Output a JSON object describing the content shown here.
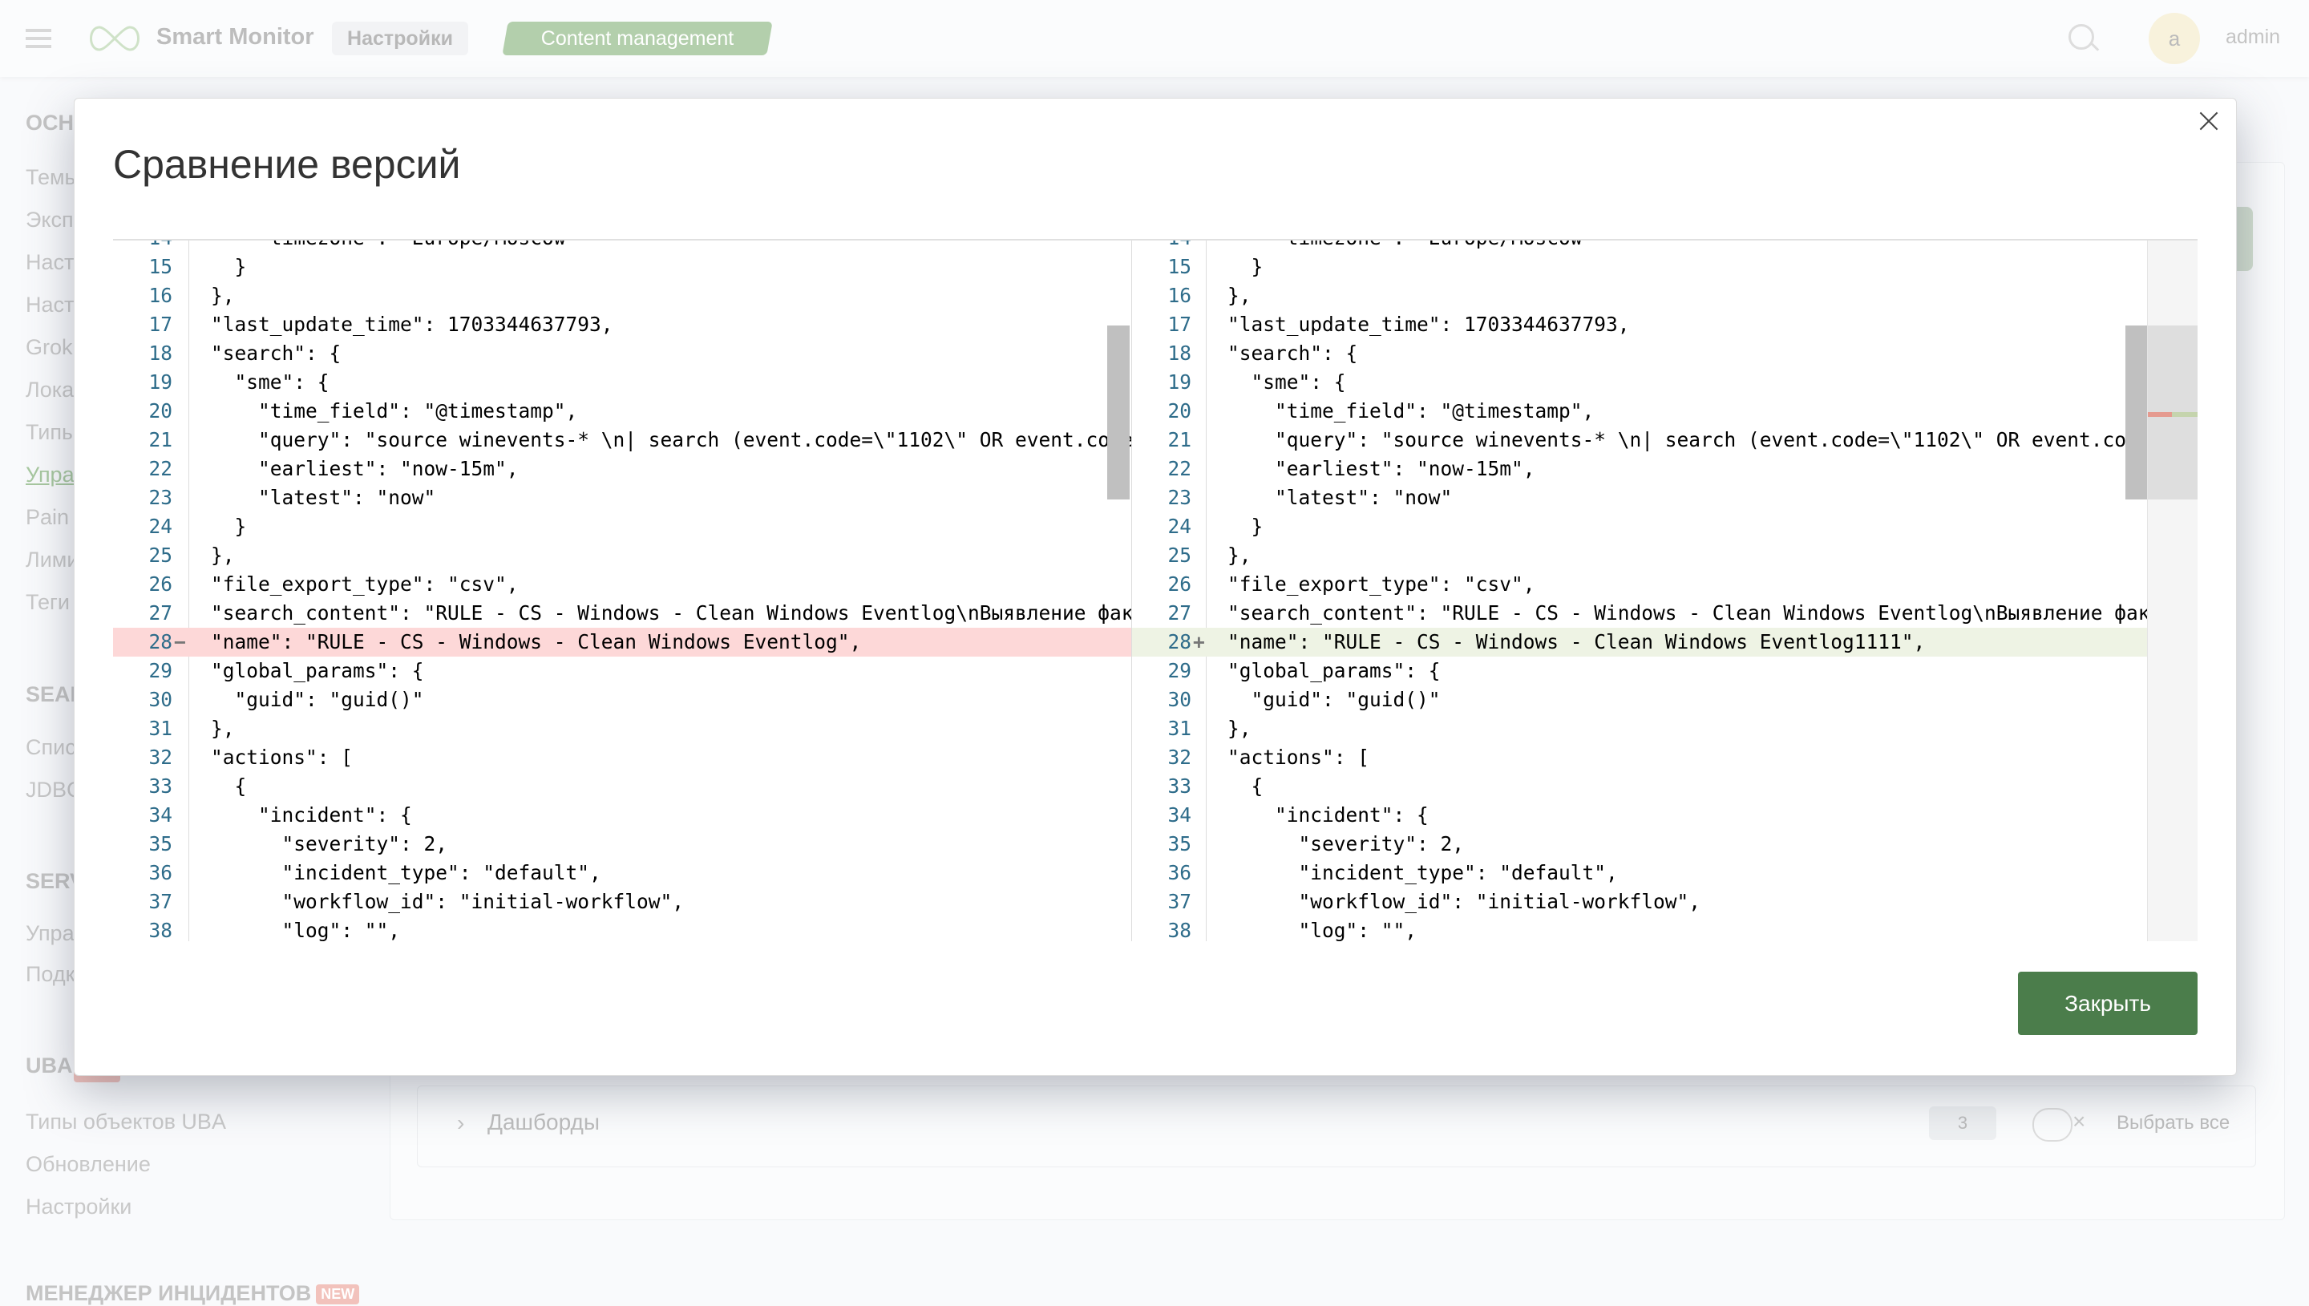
{
  "header": {
    "brand": "Smart Monitor",
    "tabs": [
      "Настройки",
      "Content management"
    ],
    "avatar_letter": "a",
    "user": "admin",
    "icons": [
      "menu-icon",
      "logo-infinity-icon",
      "search-icon"
    ]
  },
  "sidebar": {
    "items": [
      {
        "label": "ОСН",
        "type": "head"
      },
      {
        "label": "Темы",
        "type": "item"
      },
      {
        "label": "Эксп",
        "type": "item"
      },
      {
        "label": "Наст",
        "type": "item"
      },
      {
        "label": "Наст",
        "type": "item"
      },
      {
        "label": "Grok",
        "type": "item"
      },
      {
        "label": "Лока",
        "type": "item"
      },
      {
        "label": "Типы",
        "type": "item"
      },
      {
        "label": "Упра",
        "type": "active"
      },
      {
        "label": "Pain",
        "type": "item"
      },
      {
        "label": "Лими",
        "type": "item"
      },
      {
        "label": "Теги",
        "type": "item"
      },
      {
        "label": "SEAR",
        "type": "head"
      },
      {
        "label": "Спис",
        "type": "item"
      },
      {
        "label": "JDBC",
        "type": "item"
      },
      {
        "label": "SERV",
        "type": "head"
      },
      {
        "label": "Упра",
        "type": "item"
      },
      {
        "label": "Подк",
        "type": "item"
      },
      {
        "label": "UBA",
        "type": "head"
      },
      {
        "label": "Типы объектов UBA",
        "type": "item"
      },
      {
        "label": "Обновление",
        "type": "item"
      },
      {
        "label": "Настройки",
        "type": "item"
      },
      {
        "label": "МЕНЕДЖЕР ИНЦИДЕНТОВ",
        "type": "head",
        "badge": "NEW"
      }
    ]
  },
  "background_card": {
    "label": "Дашборды",
    "count": "3",
    "select_all": "Выбрать все"
  },
  "modal": {
    "title": "Сравнение версий",
    "close_button": "Закрыть",
    "colors": {
      "deleted": "#fdd8d8",
      "inserted": "#eef3e4",
      "button": "#4b7d4b",
      "ruler_deleted": "#e59a8f",
      "ruler_inserted": "#c5d4ad"
    },
    "left": {
      "lines": [
        {
          "n": "14",
          "code": "    \"timezone\": \"Europe/Moscow\""
        },
        {
          "n": "15",
          "code": "  }"
        },
        {
          "n": "16",
          "code": "},"
        },
        {
          "n": "17",
          "code": "\"last_update_time\": 1703344637793,"
        },
        {
          "n": "18",
          "code": "\"search\": {"
        },
        {
          "n": "19",
          "code": "  \"sme\": {"
        },
        {
          "n": "20",
          "code": "    \"time_field\": \"@timestamp\","
        },
        {
          "n": "21",
          "code": "    \"query\": \"source winevents-* \\n| search (event.code=\\\"1102\\\" OR event.code=\\"
        },
        {
          "n": "22",
          "code": "    \"earliest\": \"now-15m\","
        },
        {
          "n": "23",
          "code": "    \"latest\": \"now\""
        },
        {
          "n": "24",
          "code": "  }"
        },
        {
          "n": "25",
          "code": "},"
        },
        {
          "n": "26",
          "code": "\"file_export_type\": \"csv\","
        },
        {
          "n": "27",
          "code": "\"search_content\": \"RULE - CS - Windows - Clean Windows Eventlog\\nВыявление факт"
        },
        {
          "n": "28",
          "code": "\"name\": \"RULE - CS - Windows - Clean Windows Eventlog\",",
          "change": "del",
          "mark": "−"
        },
        {
          "n": "29",
          "code": "\"global_params\": {"
        },
        {
          "n": "30",
          "code": "  \"guid\": \"guid()\""
        },
        {
          "n": "31",
          "code": "},"
        },
        {
          "n": "32",
          "code": "\"actions\": ["
        },
        {
          "n": "33",
          "code": "  {"
        },
        {
          "n": "34",
          "code": "    \"incident\": {"
        },
        {
          "n": "35",
          "code": "      \"severity\": 2,"
        },
        {
          "n": "36",
          "code": "      \"incident_type\": \"default\","
        },
        {
          "n": "37",
          "code": "      \"workflow_id\": \"initial-workflow\","
        },
        {
          "n": "38",
          "code": "      \"log\": \"\","
        }
      ]
    },
    "right": {
      "lines": [
        {
          "n": "14",
          "code": "    \"timezone\": \"Europe/Moscow\""
        },
        {
          "n": "15",
          "code": "  }"
        },
        {
          "n": "16",
          "code": "},"
        },
        {
          "n": "17",
          "code": "\"last_update_time\": 1703344637793,"
        },
        {
          "n": "18",
          "code": "\"search\": {"
        },
        {
          "n": "19",
          "code": "  \"sme\": {"
        },
        {
          "n": "20",
          "code": "    \"time_field\": \"@timestamp\","
        },
        {
          "n": "21",
          "code": "    \"query\": \"source winevents-* \\n| search (event.code=\\\"1102\\\" OR event.code=\\"
        },
        {
          "n": "22",
          "code": "    \"earliest\": \"now-15m\","
        },
        {
          "n": "23",
          "code": "    \"latest\": \"now\""
        },
        {
          "n": "24",
          "code": "  }"
        },
        {
          "n": "25",
          "code": "},"
        },
        {
          "n": "26",
          "code": "\"file_export_type\": \"csv\","
        },
        {
          "n": "27",
          "code": "\"search_content\": \"RULE - CS - Windows - Clean Windows Eventlog\\nВыявление факт"
        },
        {
          "n": "28",
          "code": "\"name\": \"RULE - CS - Windows - Clean Windows Eventlog1111\",",
          "change": "ins",
          "mark": "+"
        },
        {
          "n": "29",
          "code": "\"global_params\": {"
        },
        {
          "n": "30",
          "code": "  \"guid\": \"guid()\""
        },
        {
          "n": "31",
          "code": "},"
        },
        {
          "n": "32",
          "code": "\"actions\": ["
        },
        {
          "n": "33",
          "code": "  {"
        },
        {
          "n": "34",
          "code": "    \"incident\": {"
        },
        {
          "n": "35",
          "code": "      \"severity\": 2,"
        },
        {
          "n": "36",
          "code": "      \"incident_type\": \"default\","
        },
        {
          "n": "37",
          "code": "      \"workflow_id\": \"initial-workflow\","
        },
        {
          "n": "38",
          "code": "      \"log\": \"\","
        }
      ]
    }
  }
}
